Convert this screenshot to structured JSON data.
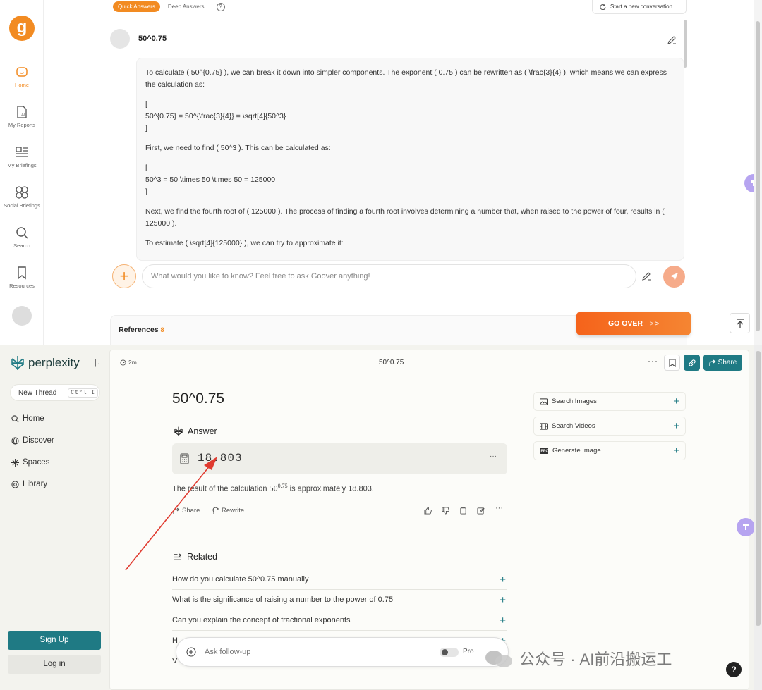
{
  "goover": {
    "logo_letter": "g",
    "nav": [
      {
        "label": "Home",
        "icon": "home-icon",
        "active": true
      },
      {
        "label": "My Reports",
        "icon": "report-icon"
      },
      {
        "label": "My Briefings",
        "icon": "briefing-icon"
      },
      {
        "label": "Social Briefings",
        "icon": "social-icon"
      },
      {
        "label": "Search",
        "icon": "search-icon"
      },
      {
        "label": "Resources",
        "icon": "bookmark-icon"
      }
    ],
    "tabs": [
      "Quick Answers",
      "Deep Answers"
    ],
    "help_glyph": "?",
    "new_conversation": "Start a new conversation",
    "question": "50^0.75",
    "answer_paragraphs": [
      "To calculate ( 50^{0.75} ), we can break it down into simpler components. The exponent ( 0.75 ) can be rewritten as ( \\frac{3}{4} ), which means we can express the calculation as:",
      "[",
      "50^{0.75} = 50^{\\frac{3}{4}} = \\sqrt[4]{50^3}",
      "]",
      "First, we need to find ( 50^3 ). This can be calculated as:",
      "[",
      "50^3 = 50 \\times 50 \\times 50 = 125000",
      "]",
      "Next, we find the fourth root of ( 125000 ). The process of finding a fourth root involves determining a number that, when raised to the power of four, results in ( 125000 ).",
      "To estimate ( \\sqrt[4]{125000} ), we can try to approximate it:"
    ],
    "input_placeholder": "What would you like to know? Feel free to ask Goover anything!",
    "plus_glyph": "+",
    "references_label": "References",
    "references_count": "8",
    "go_over_label": "GO OVER",
    "go_over_chevrons": "> >",
    "accent": "#f28b22"
  },
  "perplexity": {
    "brand": "perplexity",
    "collapse_glyph": "|←",
    "new_thread": "New Thread",
    "shortcut": "Ctrl I",
    "nav": [
      {
        "label": "Home",
        "icon": "search-icon"
      },
      {
        "label": "Discover",
        "icon": "globe-icon"
      },
      {
        "label": "Spaces",
        "icon": "spaces-icon"
      },
      {
        "label": "Library",
        "icon": "library-icon"
      }
    ],
    "sign_up": "Sign Up",
    "log_in": "Log in",
    "time_ago": "2m",
    "thread_title": "50^0.75",
    "more_glyph": "···",
    "share": "Share",
    "query": "50^0.75",
    "answer_heading": "Answer",
    "calc_value": "18.803",
    "result_prefix": "The result of the calculation",
    "result_base": "50",
    "result_exp": "0.75",
    "result_suffix": "is approximately 18.803.",
    "actions": {
      "share": "Share",
      "rewrite": "Rewrite"
    },
    "related_heading": "Related",
    "related": [
      "How do you calculate 50^0.75 manually",
      "What is the significance of raising a number to the power of 0.75",
      "Can you explain the concept of fractional exponents",
      "H",
      "V"
    ],
    "plus_glyph": "+",
    "side_cards": [
      "Search Images",
      "Search Videos",
      "Generate Image"
    ],
    "followup_placeholder": "Ask follow-up",
    "pro_label": "Pro",
    "help_glyph": "?",
    "accent": "#1f7a84"
  },
  "watermark": "公众号 · AI前沿搬运工"
}
